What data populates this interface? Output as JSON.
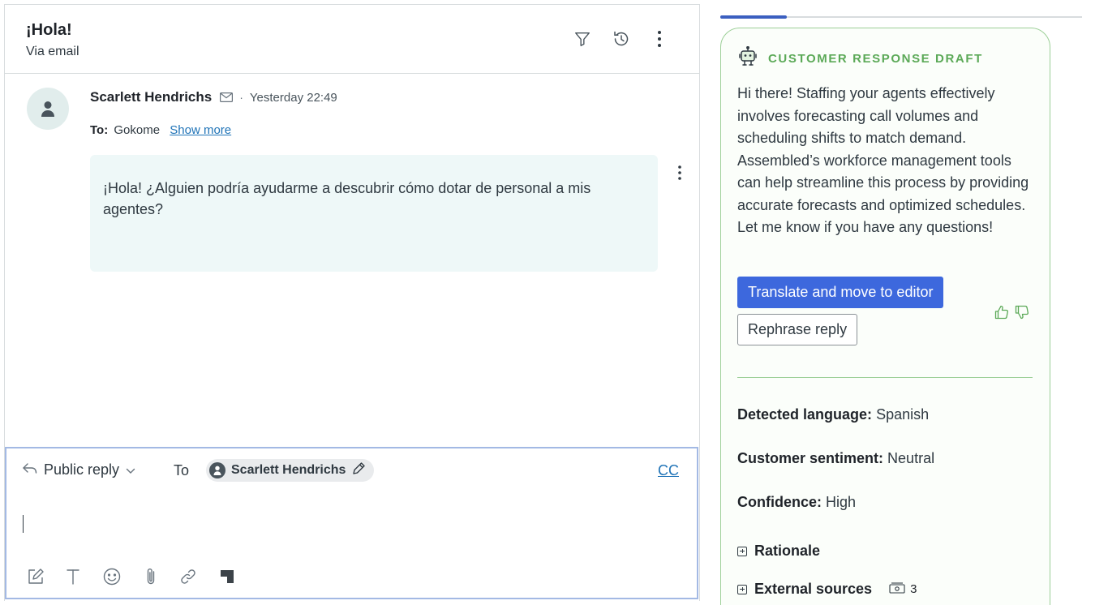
{
  "ticket": {
    "subject": "¡Hola!",
    "channel": "Via email",
    "header_icons": [
      "filter-icon",
      "history-icon",
      "more-vertical-icon"
    ]
  },
  "message": {
    "author": "Scarlett Hendrichs",
    "separator": "·",
    "timestamp": "Yesterday 22:49",
    "to_label": "To:",
    "to_value": "Gokome",
    "show_more": "Show more",
    "body": "¡Hola! ¿Alguien podría ayudarme a descubrir cómo dotar de personal a mis agentes?"
  },
  "composer": {
    "reply_type": "Public reply",
    "to_label": "To",
    "recipient": "Scarlett Hendrichs",
    "cc_label": "CC",
    "toolbar": [
      "compose-icon",
      "text-format-icon",
      "emoji-icon",
      "attachment-icon",
      "link-icon",
      "assembled-logo-icon"
    ]
  },
  "ai_panel": {
    "draft_title": "CUSTOMER RESPONSE DRAFT",
    "draft_text": "Hi there! Staffing your agents effectively involves forecasting call volumes and scheduling shifts to match demand. Assembled’s workforce management tools can help streamline this process by providing accurate forecasts and optimized schedules. Let me know if you have any questions!",
    "primary_button": "Translate and move to editor",
    "secondary_button": "Rephrase reply",
    "detected_language_label": "Detected language:",
    "detected_language_value": "Spanish",
    "sentiment_label": "Customer sentiment:",
    "sentiment_value": "Neutral",
    "confidence_label": "Confidence:",
    "confidence_value": "High",
    "rationale_label": "Rationale",
    "external_sources_label": "External sources",
    "external_sources_count": "3",
    "accent_color": "#5ba957",
    "primary_color": "#3d68dd"
  }
}
